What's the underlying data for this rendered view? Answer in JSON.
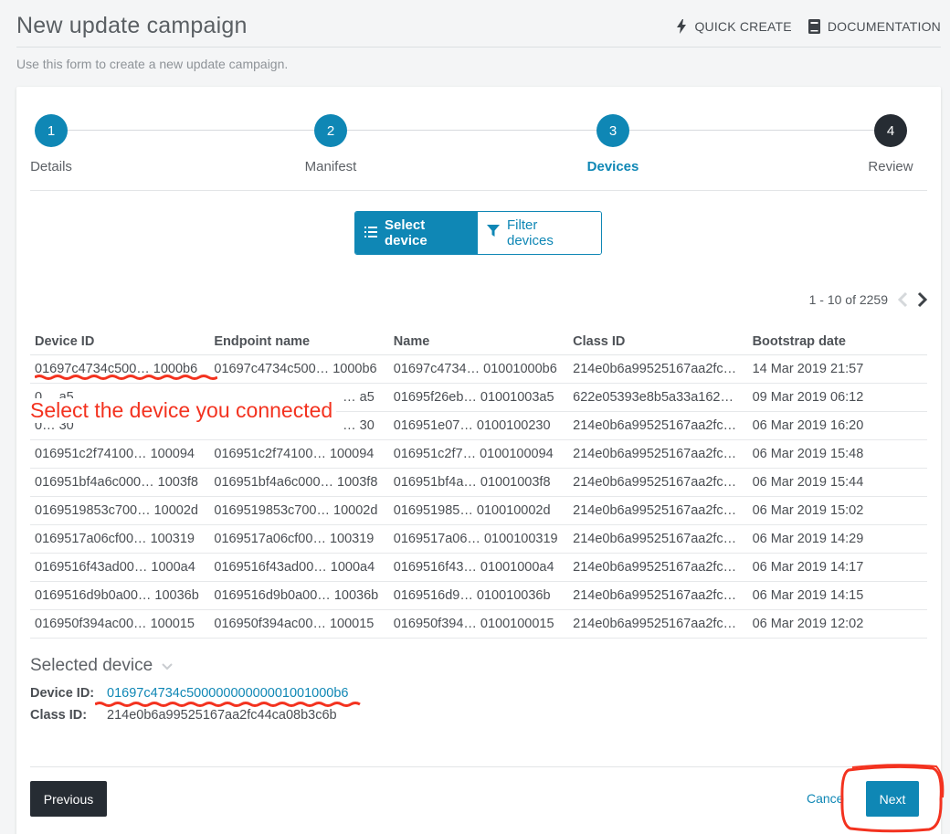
{
  "header": {
    "title": "New update campaign",
    "quick_create": "QUICK CREATE",
    "documentation": "DOCUMENTATION"
  },
  "subtitle": "Use this form to create a new update campaign.",
  "steps": [
    {
      "number": "1",
      "label": "Details"
    },
    {
      "number": "2",
      "label": "Manifest"
    },
    {
      "number": "3",
      "label": "Devices"
    },
    {
      "number": "4",
      "label": "Review"
    }
  ],
  "toggle": {
    "select_device": "Select device",
    "filter_devices": "Filter devices"
  },
  "pager": {
    "range": "1 - 10 of 2259"
  },
  "table": {
    "columns": [
      "Device ID",
      "Endpoint name",
      "Name",
      "Class ID",
      "Bootstrap date"
    ],
    "rows": [
      [
        "01697c4734c500… 1000b6",
        "01697c4734c500… 1000b6",
        "01697c4734… 01001000b6",
        "214e0b6a99525167aa2fc…",
        "14 Mar 2019 21:57"
      ],
      [
        "0… a5",
        "… a5",
        "01695f26eb… 01001003a5",
        "622e05393e8b5a33a162…",
        "09 Mar 2019 06:12"
      ],
      [
        "0… 30",
        "… 30",
        "016951e07… 0100100230",
        "214e0b6a99525167aa2fc…",
        "06 Mar 2019 16:20"
      ],
      [
        "016951c2f74100… 100094",
        "016951c2f74100… 100094",
        "016951c2f7… 0100100094",
        "214e0b6a99525167aa2fc…",
        "06 Mar 2019 15:48"
      ],
      [
        "016951bf4a6c000… 1003f8",
        "016951bf4a6c000… 1003f8",
        "016951bf4a… 01001003f8",
        "214e0b6a99525167aa2fc…",
        "06 Mar 2019 15:44"
      ],
      [
        "0169519853c700… 10002d",
        "0169519853c700… 10002d",
        "016951985… 010010002d",
        "214e0b6a99525167aa2fc…",
        "06 Mar 2019 15:02"
      ],
      [
        "0169517a06cf00… 100319",
        "0169517a06cf00… 100319",
        "0169517a06… 0100100319",
        "214e0b6a99525167aa2fc…",
        "06 Mar 2019 14:29"
      ],
      [
        "0169516f43ad00… 1000a4",
        "0169516f43ad00… 1000a4",
        "0169516f43… 01001000a4",
        "214e0b6a99525167aa2fc…",
        "06 Mar 2019 14:17"
      ],
      [
        "0169516d9b0a00… 10036b",
        "0169516d9b0a00… 10036b",
        "0169516d9… 010010036b",
        "214e0b6a99525167aa2fc…",
        "06 Mar 2019 14:15"
      ],
      [
        "016950f394ac00… 100015",
        "016950f394ac00… 100015",
        "016950f394… 0100100015",
        "214e0b6a99525167aa2fc…",
        "06 Mar 2019 12:02"
      ]
    ]
  },
  "annotation": "Select the device you connected",
  "selected": {
    "title": "Selected device",
    "device_id_label": "Device ID:",
    "device_id_value": "01697c4734c50000000000001001000b6",
    "class_id_label": "Class ID:",
    "class_id_value": "214e0b6a99525167aa2fc44ca08b3c6b"
  },
  "footer": {
    "previous": "Previous",
    "cancel": "Cancel",
    "next": "Next"
  },
  "colors": {
    "accent": "#0f87b5",
    "dark": "#262c33",
    "annotation": "#f3321f"
  }
}
